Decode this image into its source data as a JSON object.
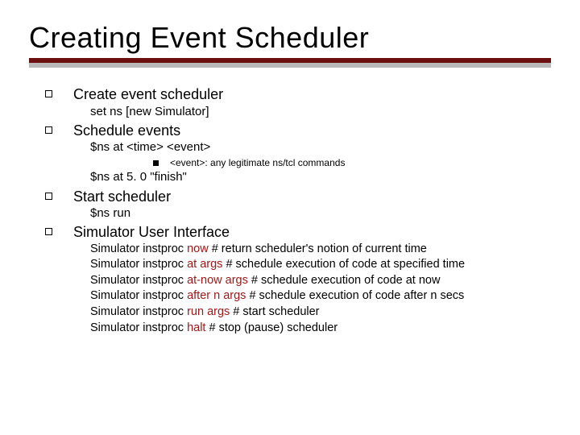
{
  "title": "Creating Event Scheduler",
  "sections": [
    {
      "heading": "Create event scheduler",
      "sub": [
        {
          "text": "set ns [new Simulator]"
        }
      ]
    },
    {
      "heading": "Schedule events",
      "sub": [
        {
          "text": "$ns at <time> <event>"
        },
        {
          "bullet": true,
          "text": "<event>: any legitimate ns/tcl commands"
        },
        {
          "text": "$ns at 5. 0 \"finish\""
        }
      ]
    },
    {
      "heading": "Start scheduler",
      "sub": [
        {
          "text": "$ns run"
        }
      ]
    },
    {
      "heading": "Simulator User Interface",
      "api": [
        {
          "prefix": "Simulator instproc ",
          "cmd": "now",
          "suffix": " # return scheduler's notion of current time"
        },
        {
          "prefix": "Simulator instproc ",
          "cmd": "at args",
          "suffix": " # schedule execution of code at specified time"
        },
        {
          "prefix": "Simulator instproc ",
          "cmd": "at-now args",
          "suffix": " # schedule execution of code at now"
        },
        {
          "prefix": "Simulator instproc ",
          "cmd": "after n args",
          "suffix": " # schedule execution of code after n secs"
        },
        {
          "prefix": "Simulator instproc ",
          "cmd": "run args",
          "suffix": " # start scheduler"
        },
        {
          "prefix": "Simulator instproc ",
          "cmd": "halt",
          "suffix": " # stop (pause) scheduler"
        }
      ]
    }
  ]
}
